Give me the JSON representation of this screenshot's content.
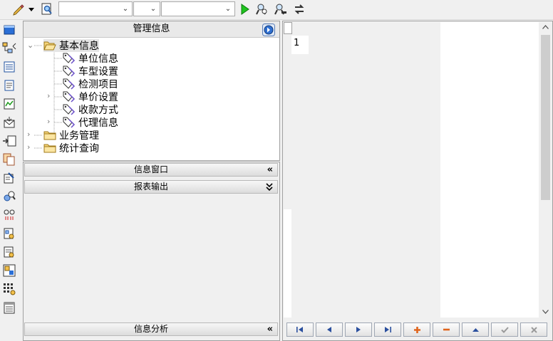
{
  "toolbar": {
    "combo1_value": "",
    "combo2_value": "",
    "combo3_value": "",
    "icons": [
      "pencil-icon",
      "dropdown-arrow-icon",
      "preview-icon",
      "run-icon",
      "find-icon",
      "find-next-icon",
      "refresh-icon"
    ]
  },
  "left_strip": {
    "icons": [
      "window-icon",
      "hierarchy-icon",
      "list-icon",
      "document-icon",
      "chart-icon",
      "mail-icon",
      "export-icon",
      "copy-icon",
      "tools-icon",
      "search-user-icon",
      "link-icon",
      "report-icon",
      "report-settings-icon",
      "layout-icon",
      "grid-icon",
      "clipboard-icon"
    ]
  },
  "tree_panel": {
    "title": "管理信息",
    "root_items": [
      {
        "label": "基本信息",
        "children": [
          "单位信息",
          "车型设置",
          "检测项目",
          "单价设置",
          "收款方式",
          "代理信息"
        ]
      },
      {
        "label": "业务管理"
      },
      {
        "label": "统计查询"
      }
    ]
  },
  "sections": {
    "info_window": "信息窗口",
    "report_output": "报表输出",
    "info_analysis": "信息分析"
  },
  "grid": {
    "row_number": "1"
  },
  "navigator": {
    "buttons": [
      "first",
      "prior",
      "next",
      "last",
      "insert",
      "delete",
      "edit",
      "post",
      "cancel"
    ]
  }
}
